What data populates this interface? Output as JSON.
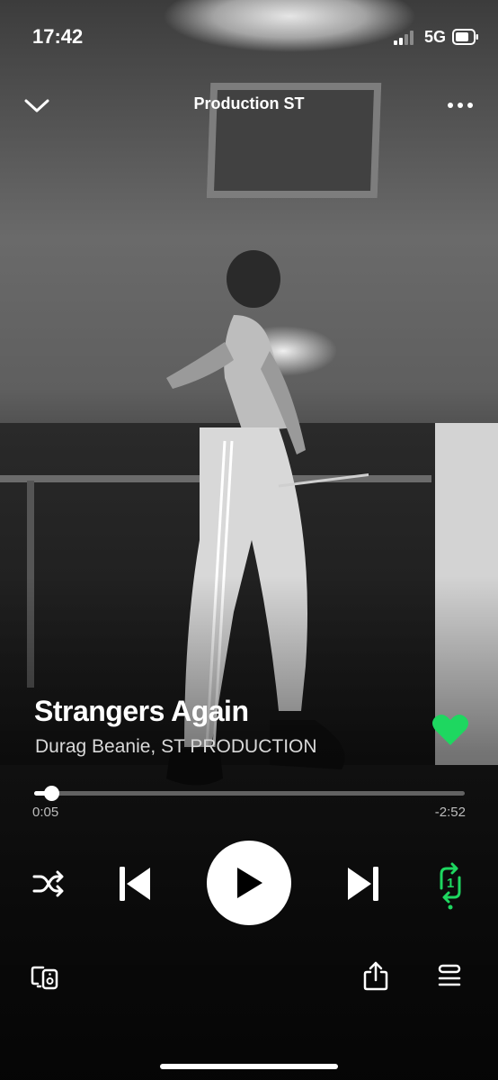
{
  "status_bar": {
    "time": "17:42",
    "network": "5G"
  },
  "header": {
    "playlist_title": "Production ST",
    "collapse_icon": "chevron-down-icon",
    "more_icon": "more-dots-icon"
  },
  "track": {
    "title": "Strangers Again",
    "artists": "Durag Beanie, ST PRODUCTION",
    "liked": true
  },
  "playback": {
    "elapsed": "0:05",
    "remaining": "-2:52",
    "progress_fraction": 0.04
  },
  "controls": {
    "shuffle_icon": "shuffle-icon",
    "previous_icon": "previous-track-icon",
    "play_icon": "play-icon",
    "next_icon": "next-track-icon",
    "repeat_icon": "repeat-one-icon",
    "repeat_one_label": "1"
  },
  "bottom_bar": {
    "devices_icon": "connect-devices-icon",
    "share_icon": "share-icon",
    "queue_icon": "queue-icon"
  },
  "colors": {
    "accent": "#1ed760",
    "text": "#ffffff",
    "muted": "#bdbdbd"
  }
}
